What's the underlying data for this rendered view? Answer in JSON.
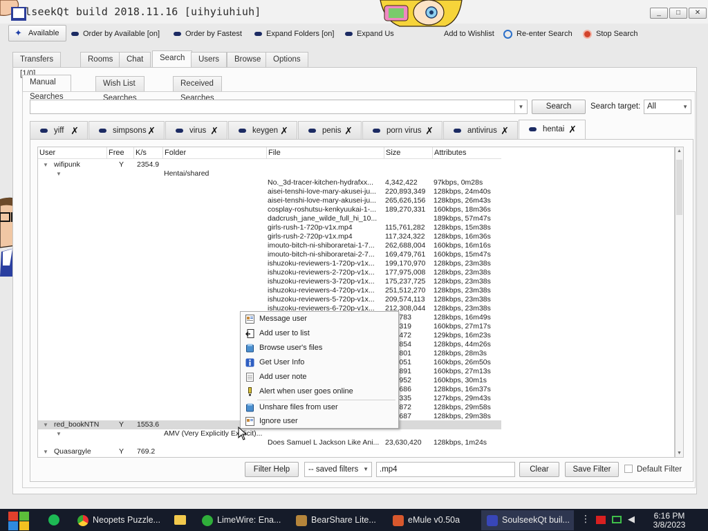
{
  "window": {
    "title": "lseekQt build 2018.11.16 [uihyiuhiuh]",
    "controls": [
      "_",
      "□",
      "✕"
    ]
  },
  "toolbar": {
    "available": "Available",
    "order_available": "Order by Available [on]",
    "order_fastest": "Order by Fastest",
    "expand_folders": "Expand Folders [on]",
    "expand_users": "Expand Us",
    "add_wishlist": "Add to Wishlist",
    "reenter_search": "Re-enter Search",
    "stop_search": "Stop Search"
  },
  "main_tabs": [
    "Transfers [1/0]",
    "Rooms",
    "Chat",
    "Search",
    "Users",
    "Browse",
    "Options"
  ],
  "sub_tabs": [
    "Manual Searches",
    "Wish List Searches",
    "Received Searches"
  ],
  "search": {
    "query_value": "",
    "button": "Search",
    "target_label": "Search target:",
    "target_value": "All"
  },
  "query_tabs": [
    "yiff",
    "simpsons",
    "virus",
    "keygen",
    "penis",
    "porn virus",
    "antivirus",
    "hentai"
  ],
  "columns": [
    "User",
    "Free",
    "K/s",
    "Folder",
    "File",
    "Size",
    "Attributes"
  ],
  "results": {
    "user1": {
      "user": "wifipunk",
      "free": "Y",
      "speed": "2354.9",
      "folder": "Hentai/shared"
    },
    "files": [
      {
        "file": "No._3d-tracer-kitchen-hydrafxx...",
        "size": "4,342,422",
        "attr": "97kbps, 0m28s"
      },
      {
        "file": "aisei-tenshi-love-mary-akusei-ju...",
        "size": "220,893,349",
        "attr": "128kbps, 24m40s"
      },
      {
        "file": "aisei-tenshi-love-mary-akusei-ju...",
        "size": "265,626,156",
        "attr": "128kbps, 26m43s"
      },
      {
        "file": "cosplay-roshutsu-kenkyuukai-1-...",
        "size": "189,270,331",
        "attr": "160kbps, 18m36s"
      },
      {
        "file": "dadcrush_jane_wilde_full_hi_10...",
        "size": "",
        "attr": "189kbps, 57m47s"
      },
      {
        "file": "girls-rush-1-720p-v1x.mp4",
        "size": "115,761,282",
        "attr": "128kbps, 15m38s"
      },
      {
        "file": "girls-rush-2-720p-v1x.mp4",
        "size": "117,324,322",
        "attr": "128kbps, 16m36s"
      },
      {
        "file": "imouto-bitch-ni-shiboraretai-1-7...",
        "size": "262,688,004",
        "attr": "160kbps, 16m16s"
      },
      {
        "file": "imouto-bitch-ni-shiboraretai-2-7...",
        "size": "169,479,761",
        "attr": "160kbps, 15m47s"
      },
      {
        "file": "ishuzoku-reviewers-1-720p-v1x...",
        "size": "199,170,970",
        "attr": "128kbps, 23m38s"
      },
      {
        "file": "ishuzoku-reviewers-2-720p-v1x...",
        "size": "177,975,008",
        "attr": "128kbps, 23m38s"
      },
      {
        "file": "ishuzoku-reviewers-3-720p-v1x...",
        "size": "175,237,725",
        "attr": "128kbps, 23m38s"
      },
      {
        "file": "ishuzoku-reviewers-4-720p-v1x...",
        "size": "251,512,270",
        "attr": "128kbps, 23m38s"
      },
      {
        "file": "ishuzoku-reviewers-5-720p-v1x...",
        "size": "209,574,113",
        "attr": "128kbps, 23m38s"
      },
      {
        "file": "ishuzoku-reviewers-6-720p-v1x...",
        "size": "212,308,044",
        "attr": "128kbps, 23m38s"
      },
      {
        "file": "",
        "size": "292,783",
        "attr": "128kbps, 16m49s"
      },
      {
        "file": "",
        "size": "523,319",
        "attr": "160kbps, 27m17s"
      },
      {
        "file": "",
        "size": "960,472",
        "attr": "129kbps, 16m23s"
      },
      {
        "file": "",
        "size": "922,854",
        "attr": "128kbps, 44m26s"
      },
      {
        "file": "",
        "size": "333,801",
        "attr": "128kbps, 28m3s"
      },
      {
        "file": "",
        "size": "822,051",
        "attr": "160kbps, 26m50s"
      },
      {
        "file": "",
        "size": "421,891",
        "attr": "160kbps, 27m13s"
      },
      {
        "file": "",
        "size": "054,952",
        "attr": "160kbps, 30m1s"
      },
      {
        "file": "",
        "size": "519,686",
        "attr": "128kbps, 16m37s"
      },
      {
        "file": "",
        "size": "276,335",
        "attr": "127kbps, 29m43s"
      },
      {
        "file": "",
        "size": "731,872",
        "attr": "128kbps, 29m58s"
      },
      {
        "file": "",
        "size": "195,687",
        "attr": "128kbps, 29m38s"
      }
    ],
    "user2": {
      "user": "red_bookNTN",
      "free": "Y",
      "speed": "1553.6",
      "folder": "AMV (Very Explicitly Explicit)...",
      "file": "Does Samuel L Jackson Like Ani...",
      "size": "23,630,420",
      "attr": "128kbps, 1m24s"
    },
    "user3": {
      "user": "Quasargyle",
      "free": "Y",
      "speed": "769.2"
    }
  },
  "context_menu": {
    "message_user": "Message user",
    "add_user": "Add user to list",
    "browse_files": "Browse user's files",
    "user_info": "Get User Info",
    "user_note": "Add user note",
    "alert_online": "Alert when user goes online",
    "unshare": "Unshare files from user",
    "ignore": "Ignore user"
  },
  "filter_bar": {
    "help": "Filter Help",
    "saved_filters": "-- saved filters",
    "filter_value": ".mp4",
    "clear": "Clear",
    "save_filter": "Save Filter",
    "default_filter": "Default Filter"
  },
  "taskbar": {
    "items": [
      "Neopets Puzzle...",
      "LimeWire: Ena...",
      "BearShare Lite...",
      "eMule v0.50a",
      "SoulseekQt buil..."
    ],
    "time": "6:16 PM",
    "date": "3/8/2023"
  },
  "colors": {
    "accent": "#1c2b63",
    "taskbar": "#151b29",
    "stop": "#d2432b"
  }
}
